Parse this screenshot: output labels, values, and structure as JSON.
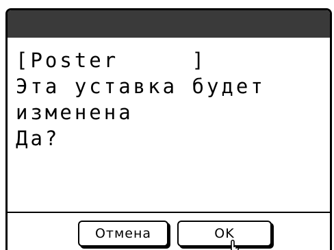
{
  "dialog": {
    "message_lines": [
      "[Poster     ]",
      "Эта уставка будет",
      "изменена",
      "Да?"
    ]
  },
  "buttons": {
    "cancel_label": "Отмена",
    "ok_label": "OK"
  },
  "icons": {
    "pointer": "hand-pointer-icon"
  }
}
